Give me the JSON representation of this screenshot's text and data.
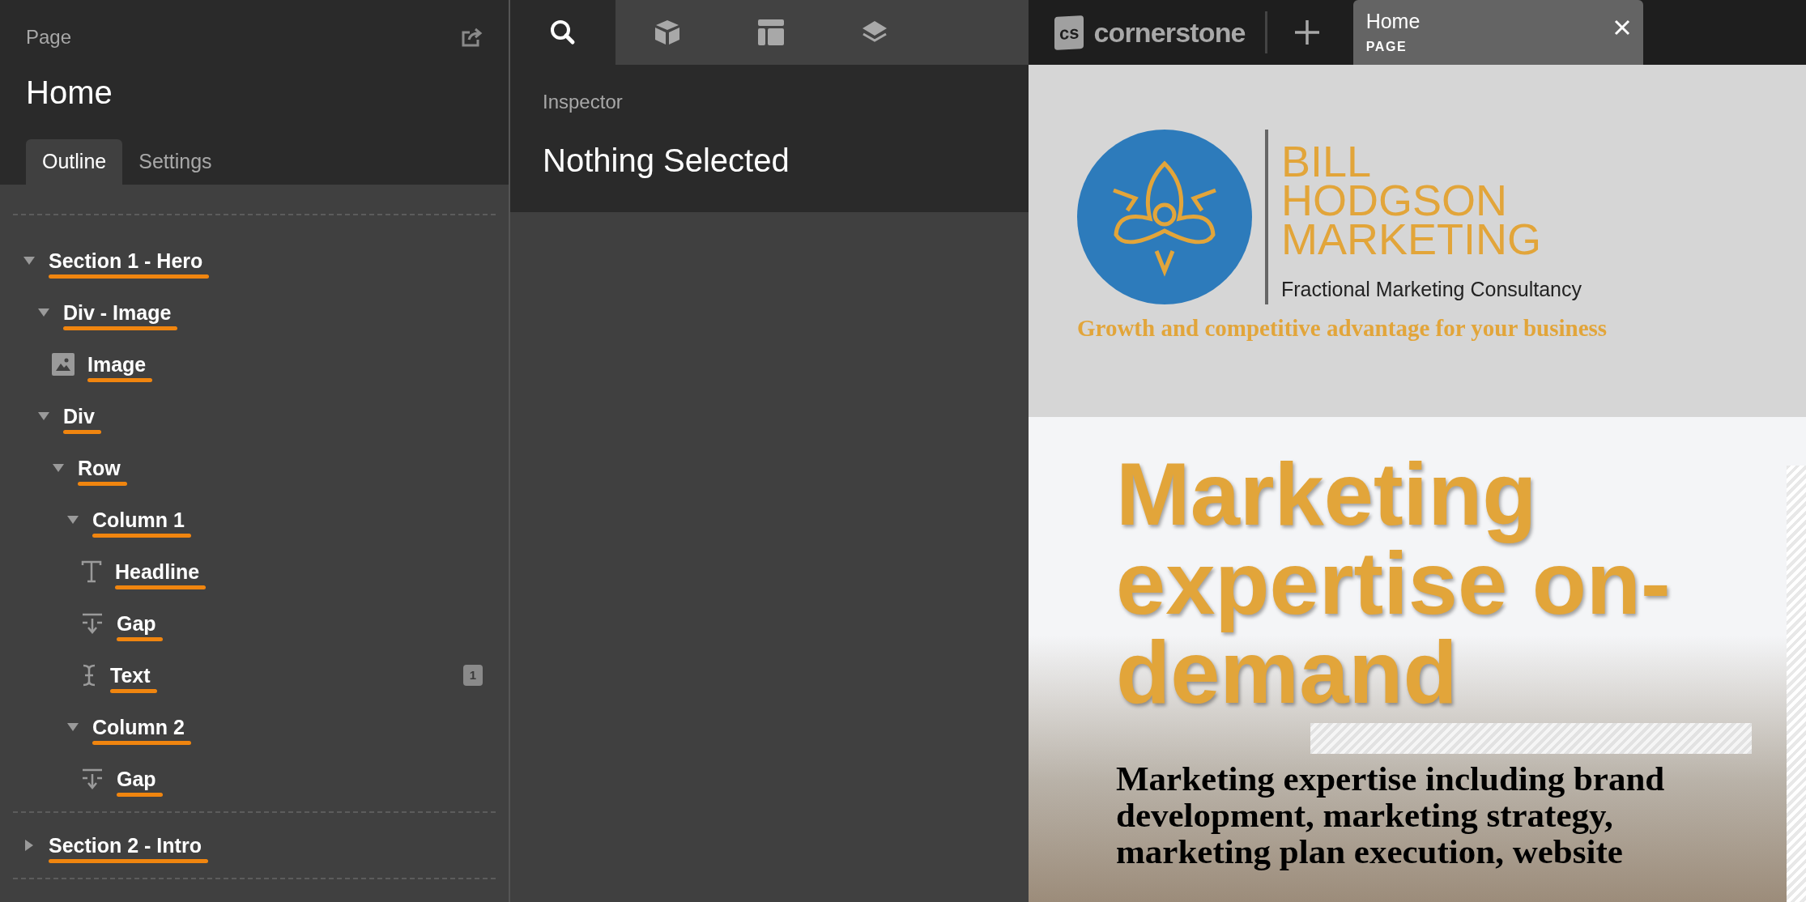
{
  "page_panel": {
    "label": "Page",
    "title": "Home",
    "tabs": [
      {
        "label": "Outline",
        "selected": true
      },
      {
        "label": "Settings",
        "selected": false
      }
    ]
  },
  "outline": [
    {
      "label": "Section 1 - Hero",
      "kind": "group",
      "expanded": true,
      "struck": true,
      "children": [
        {
          "label": "Div - Image",
          "kind": "group",
          "expanded": true,
          "struck": true,
          "children": [
            {
              "label": "Image",
              "kind": "image",
              "struck": true
            }
          ]
        },
        {
          "label": "Div",
          "kind": "group",
          "expanded": true,
          "struck": true,
          "children": [
            {
              "label": "Row",
              "kind": "group",
              "expanded": true,
              "struck": true,
              "children": [
                {
                  "label": "Column 1",
                  "kind": "group",
                  "expanded": true,
                  "struck": true,
                  "children": [
                    {
                      "label": "Headline",
                      "kind": "headline",
                      "struck": true
                    },
                    {
                      "label": "Gap",
                      "kind": "gap",
                      "struck": true
                    },
                    {
                      "label": "Text",
                      "kind": "text",
                      "struck": true,
                      "badge": "1"
                    }
                  ]
                },
                {
                  "label": "Column 2",
                  "kind": "group",
                  "expanded": true,
                  "struck": true,
                  "children": [
                    {
                      "label": "Gap",
                      "kind": "gap",
                      "struck": true
                    }
                  ]
                }
              ]
            }
          ]
        }
      ]
    },
    {
      "label": "Section 2 - Intro",
      "kind": "group",
      "expanded": false,
      "struck": true
    }
  ],
  "toolbar": [
    {
      "kind": "search",
      "selected": true
    },
    {
      "kind": "elements",
      "selected": false
    },
    {
      "kind": "layout",
      "selected": false
    },
    {
      "kind": "layers",
      "selected": false
    }
  ],
  "inspector": {
    "label": "Inspector",
    "title": "Nothing Selected"
  },
  "topbar": {
    "logo_mark": "cs",
    "logo_text": "cornerstone",
    "tab": {
      "title": "Home",
      "subtitle": "PAGE"
    }
  },
  "preview": {
    "brand_lines": [
      "BILL",
      "HODGSON",
      "MARKETING"
    ],
    "brand_subtitle": "Fractional Marketing Consultancy",
    "tagline": "Growth and competitive advantage for your business",
    "headline": "Marketing expertise on-demand",
    "body": "Marketing expertise including brand development, marketing strategy, marketing plan execution, website"
  }
}
